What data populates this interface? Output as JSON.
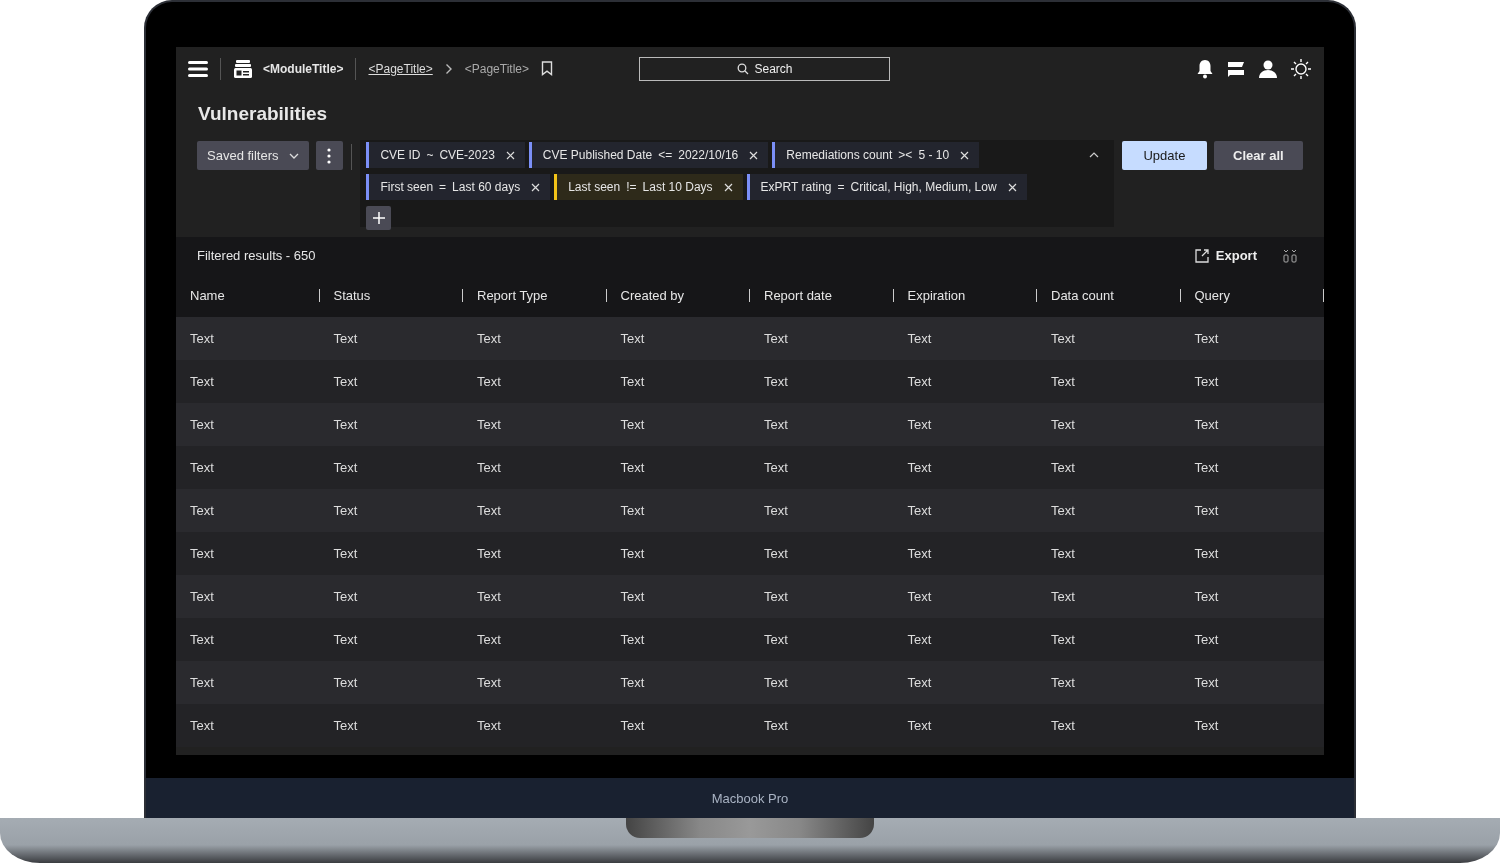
{
  "topbar": {
    "module_title": "<ModuleTitle>",
    "breadcrumb": [
      {
        "label": "<PageTitle>",
        "link": true
      },
      {
        "label": "<PageTitle>",
        "link": false
      }
    ],
    "search": {
      "placeholder": "Search"
    }
  },
  "page_title": "Vulnerabilities",
  "saved_filters": "Saved filters",
  "filters": [
    {
      "field": "CVE ID",
      "operator": "~",
      "value": "CVE-2023",
      "color": "#7b8ff7"
    },
    {
      "field": "CVE Published Date",
      "operator": "<=",
      "value": "2022/10/16",
      "color": "#7b8ff7"
    },
    {
      "field": "Remediations count",
      "operator": "><",
      "value": "5 - 10",
      "color": "#7b8ff7"
    },
    {
      "field": "First seen",
      "operator": "=",
      "value": "Last 60 days",
      "color": "#7b8ff7"
    },
    {
      "field": "Last seen",
      "operator": "!=",
      "value": "Last 10 Days",
      "color": "#f2c318"
    },
    {
      "field": "ExPRT rating",
      "operator": "=",
      "value": "Critical, High, Medium, Low",
      "color": "#7b8ff7"
    }
  ],
  "buttons": {
    "update": "Update",
    "clear": "Clear all"
  },
  "results": {
    "summary": "Filtered results - 650",
    "export": "Export"
  },
  "table": {
    "columns": [
      "Name",
      "Status",
      "Report Type",
      "Created by",
      "Report date",
      "Expiration",
      "Data count",
      "Query"
    ],
    "rows": [
      [
        "Text",
        "Text",
        "Text",
        "Text",
        "Text",
        "Text",
        "Text",
        "Text"
      ],
      [
        "Text",
        "Text",
        "Text",
        "Text",
        "Text",
        "Text",
        "Text",
        "Text"
      ],
      [
        "Text",
        "Text",
        "Text",
        "Text",
        "Text",
        "Text",
        "Text",
        "Text"
      ],
      [
        "Text",
        "Text",
        "Text",
        "Text",
        "Text",
        "Text",
        "Text",
        "Text"
      ],
      [
        "Text",
        "Text",
        "Text",
        "Text",
        "Text",
        "Text",
        "Text",
        "Text"
      ],
      [
        "Text",
        "Text",
        "Text",
        "Text",
        "Text",
        "Text",
        "Text",
        "Text"
      ],
      [
        "Text",
        "Text",
        "Text",
        "Text",
        "Text",
        "Text",
        "Text",
        "Text"
      ],
      [
        "Text",
        "Text",
        "Text",
        "Text",
        "Text",
        "Text",
        "Text",
        "Text"
      ],
      [
        "Text",
        "Text",
        "Text",
        "Text",
        "Text",
        "Text",
        "Text",
        "Text"
      ],
      [
        "Text",
        "Text",
        "Text",
        "Text",
        "Text",
        "Text",
        "Text",
        "Text"
      ]
    ]
  },
  "device_label": "Macbook Pro"
}
